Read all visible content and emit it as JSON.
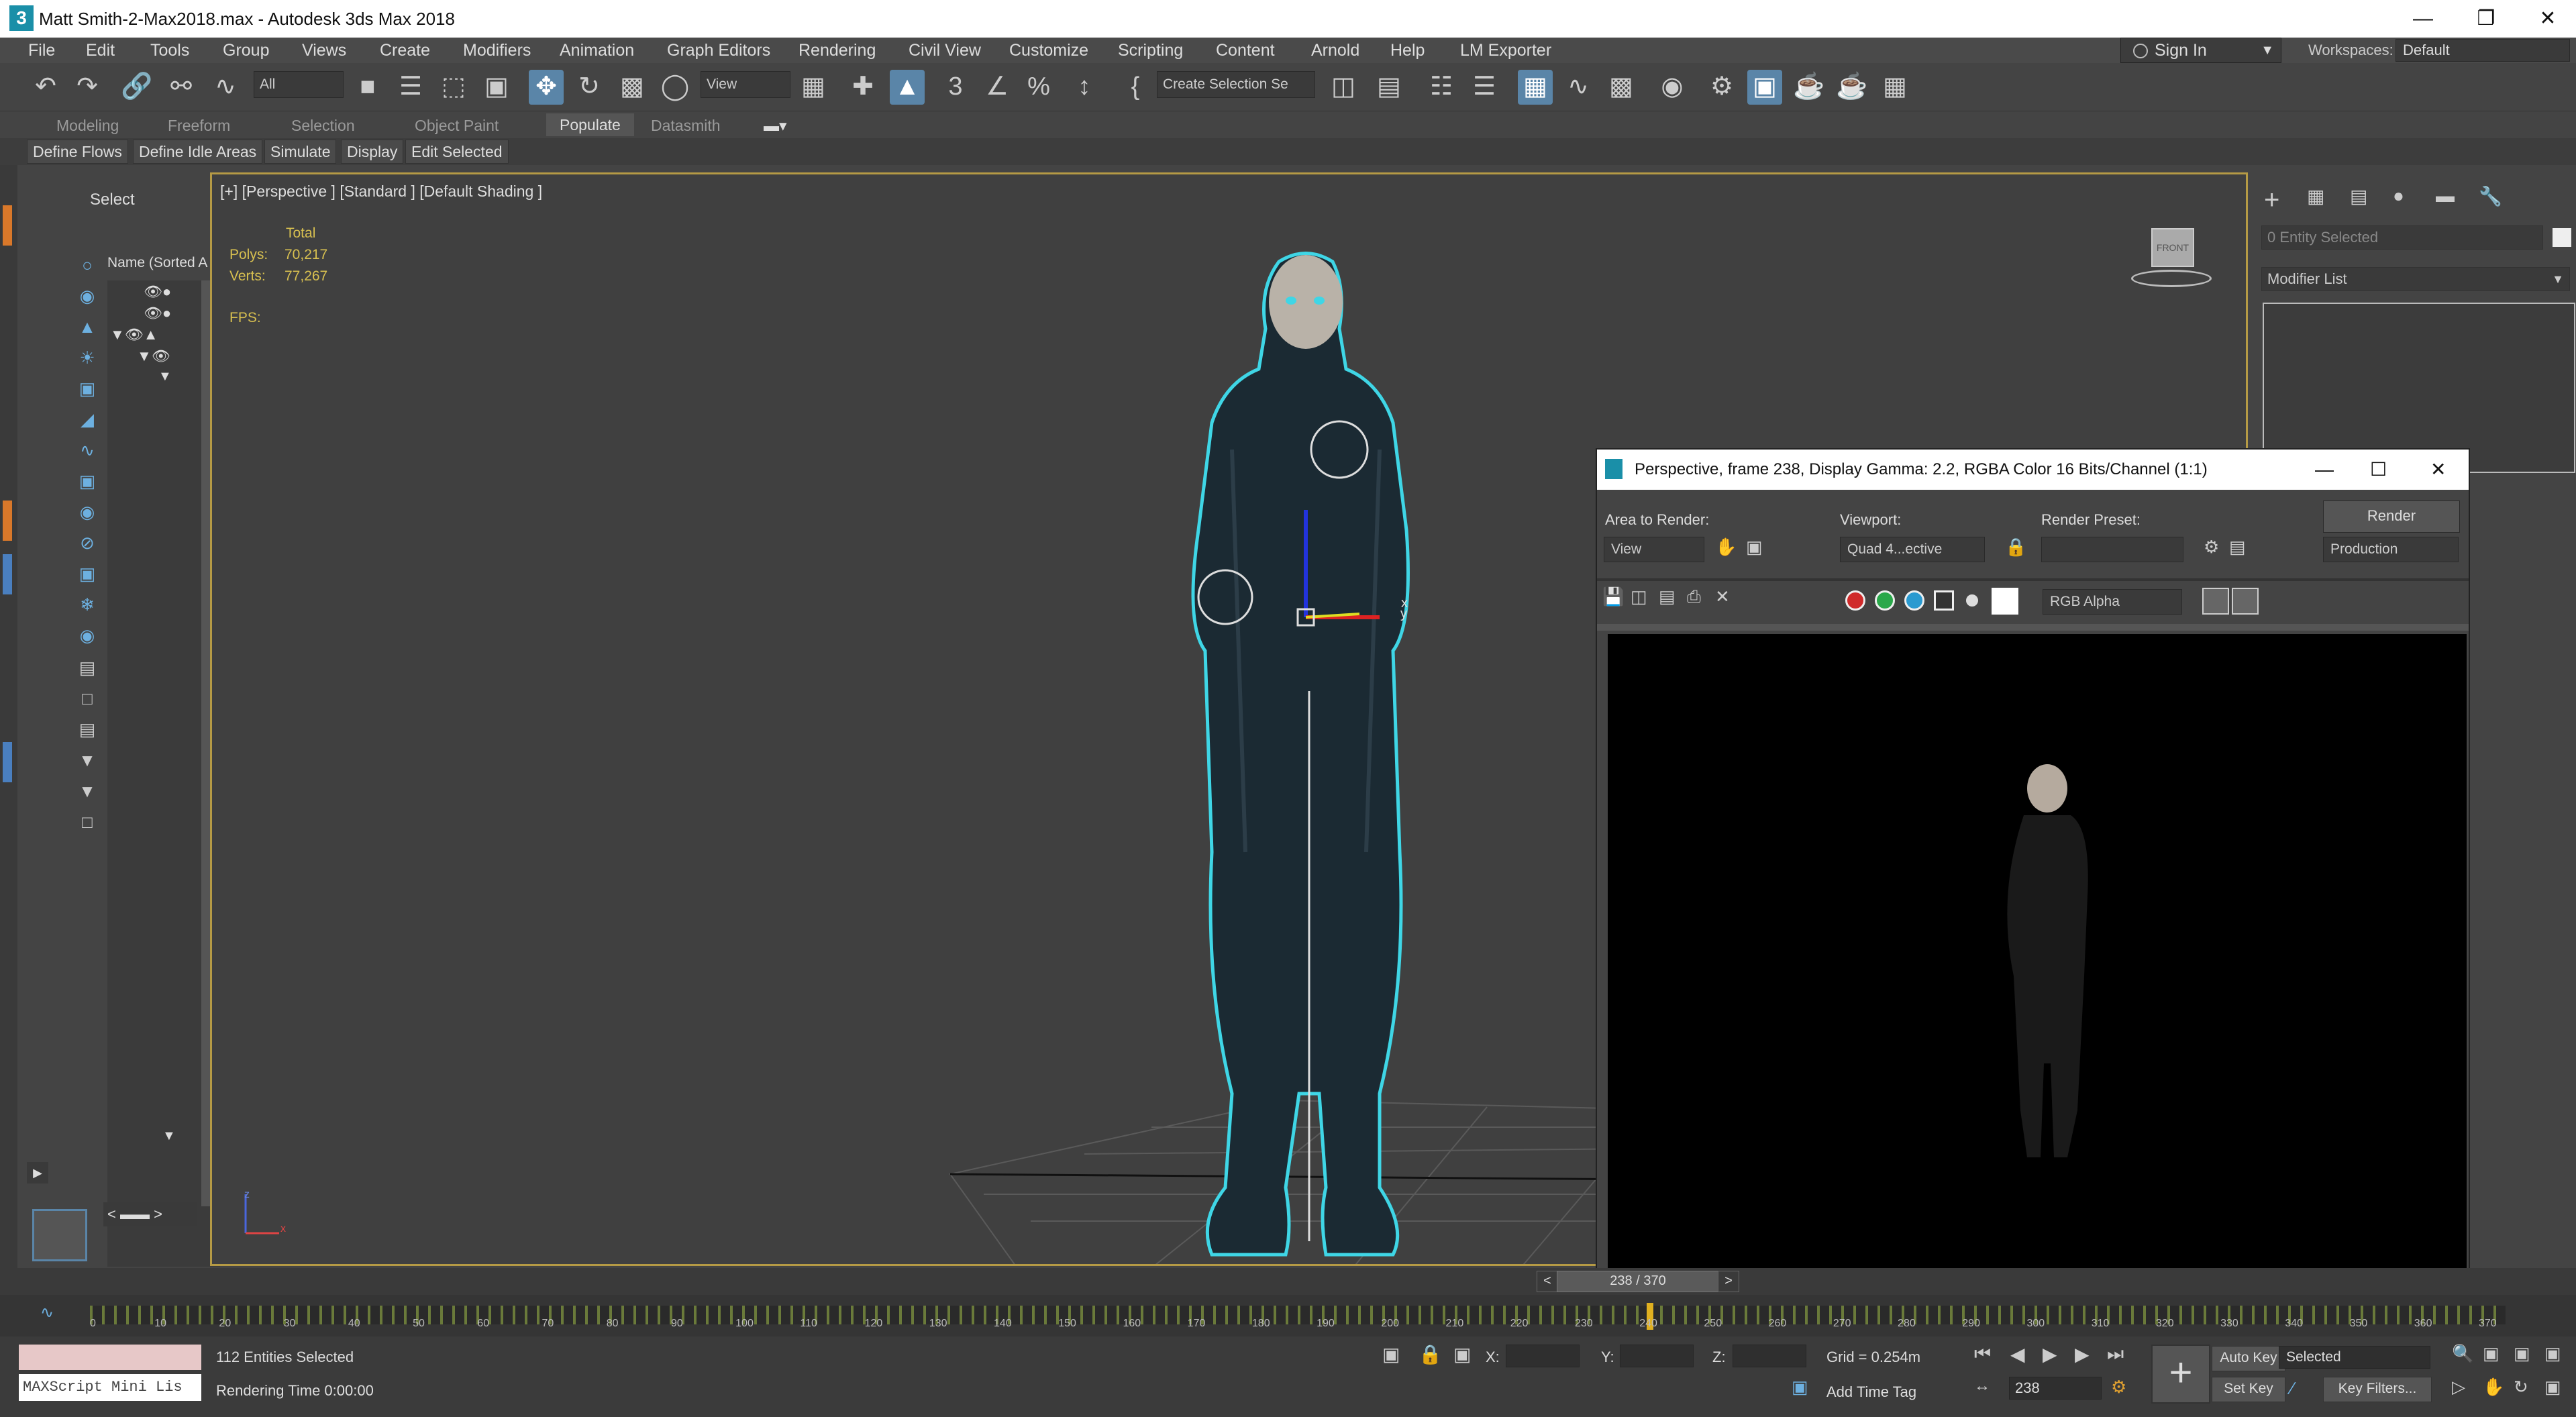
{
  "window": {
    "title": "Matt Smith-2-Max2018.max - Autodesk 3ds Max 2018",
    "app_icon": "3"
  },
  "menu": [
    "File",
    "Edit",
    "Tools",
    "Group",
    "Views",
    "Create",
    "Modifiers",
    "Animation",
    "Graph Editors",
    "Rendering",
    "Civil View",
    "Customize",
    "Scripting",
    "Content",
    "Arnold",
    "Help",
    "LM Exporter"
  ],
  "account": {
    "sign_in": "Sign In",
    "workspaces_label": "Workspaces:",
    "workspace_value": "Default"
  },
  "toolbar": {
    "filter_value": "All",
    "ref_coord": "View",
    "selection_set": "Create Selection Se"
  },
  "ribbon": {
    "tabs": [
      "Modeling",
      "Freeform",
      "Selection",
      "Object Paint",
      "Populate",
      "Datasmith"
    ],
    "active_tab": "Populate",
    "buttons": [
      "Define Flows",
      "Define Idle Areas",
      "Simulate",
      "Display",
      "Edit Selected"
    ]
  },
  "explorer": {
    "select_label": "Select",
    "column": "Name (Sorted A"
  },
  "viewport": {
    "label": "[+] [Perspective ] [Standard ] [Default Shading ]",
    "stats": {
      "total_label": "Total",
      "polys_label": "Polys:",
      "polys_value": "70,217",
      "verts_label": "Verts:",
      "verts_value": "77,267",
      "fps_label": "FPS:"
    },
    "viewcube": "FRONT",
    "axis_x": "x",
    "axis_y": "y",
    "triad_z": "z",
    "triad_x": "x"
  },
  "command_panel": {
    "entity_field": "0 Entity Selected",
    "modifier_list": "Modifier List"
  },
  "render_window": {
    "title": "Perspective, frame 238, Display Gamma: 2.2, RGBA Color 16 Bits/Channel (1:1)",
    "area_label": "Area to Render:",
    "area_value": "View",
    "viewport_label": "Viewport:",
    "viewport_value": "Quad 4...ective",
    "preset_label": "Render Preset:",
    "preset_value": "",
    "render_button": "Render",
    "mode_value": "Production",
    "channel_value": "RGB Alpha"
  },
  "timeline": {
    "frame_display": "238 / 370",
    "ticks": [
      "0",
      "10",
      "20",
      "30",
      "40",
      "50",
      "60",
      "70",
      "80",
      "90",
      "100",
      "110",
      "120",
      "130",
      "140",
      "150",
      "160",
      "170",
      "180",
      "190",
      "200",
      "210",
      "220",
      "230",
      "240",
      "250",
      "260",
      "270",
      "280",
      "290",
      "300",
      "310",
      "320",
      "330",
      "340",
      "350",
      "360",
      "370"
    ]
  },
  "status": {
    "maxscript": "MAXScript Mini Lis",
    "selection": "112 Entities Selected",
    "render_time": "Rendering Time  0:00:00",
    "x_label": "X:",
    "y_label": "Y:",
    "z_label": "Z:",
    "grid": "Grid = 0.254m",
    "add_time_tag": "Add Time Tag",
    "auto_key": "Auto Key",
    "set_key": "Set Key",
    "key_mode": "Selected",
    "key_filters": "Key Filters...",
    "current_frame": "238"
  },
  "colors": {
    "selection_outline": "#3fd6e6",
    "active_border": "#b59a45",
    "active_tool": "#5a85a8"
  }
}
